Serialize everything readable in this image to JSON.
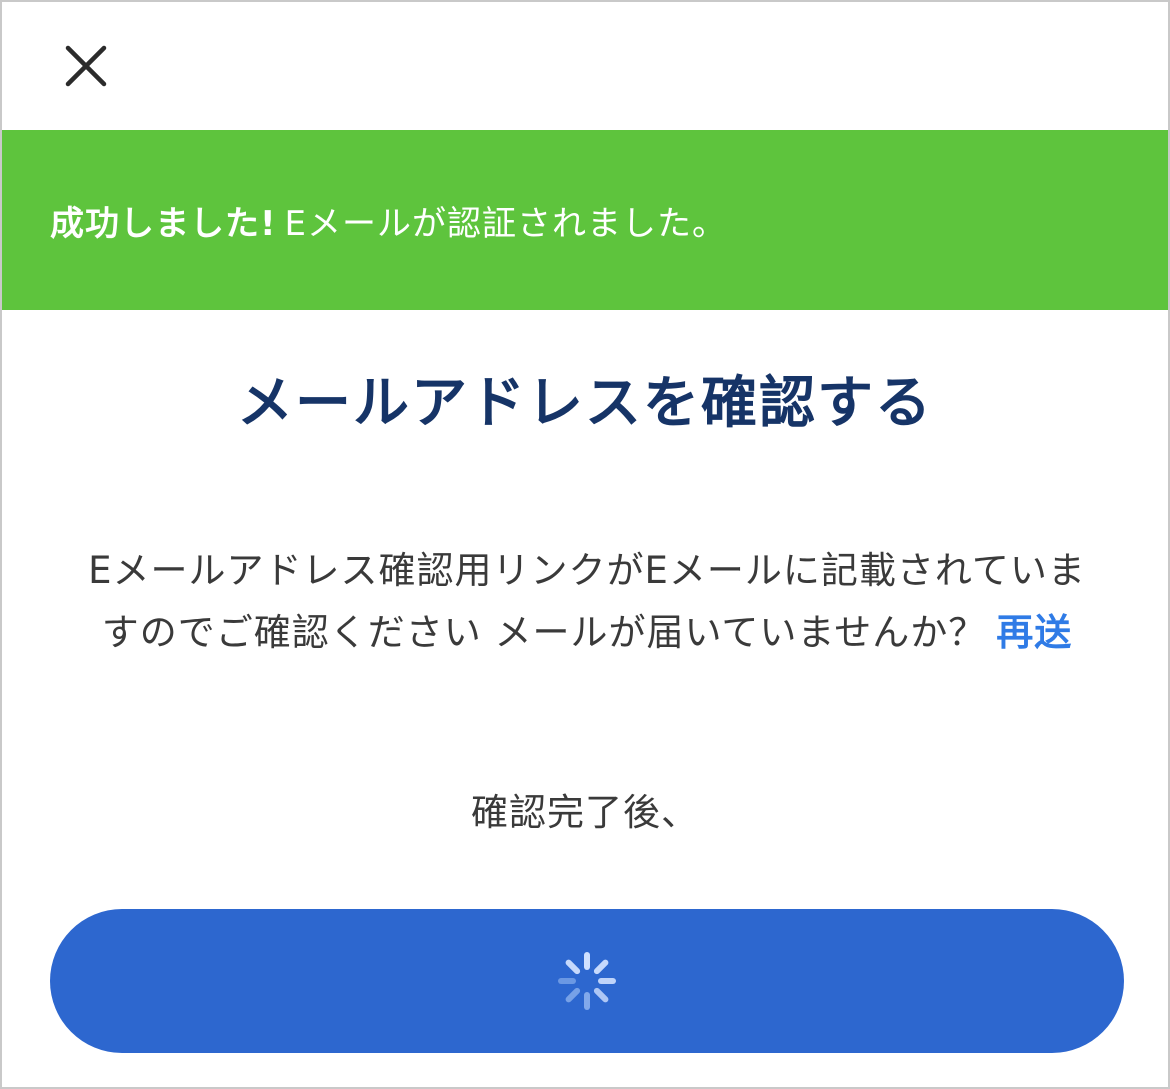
{
  "header": {
    "close_icon": "close-icon"
  },
  "banner": {
    "status_label": "成功しました!",
    "message": "Eメールが認証されました。",
    "color": "#5ec43d"
  },
  "page": {
    "title": "メールアドレスを確認する",
    "instruction": "Eメールアドレス確認用リンクがEメールに記載されていますのでご確認ください メールが届いていませんか？",
    "resend_label": "再送",
    "after_confirm": "確認完了後、"
  },
  "primary_button": {
    "state": "loading",
    "icon": "loading-spinner-icon",
    "color": "#2d67cf"
  },
  "colors": {
    "title": "#163467",
    "link": "#2f7be6",
    "text": "#3a3a3a"
  }
}
